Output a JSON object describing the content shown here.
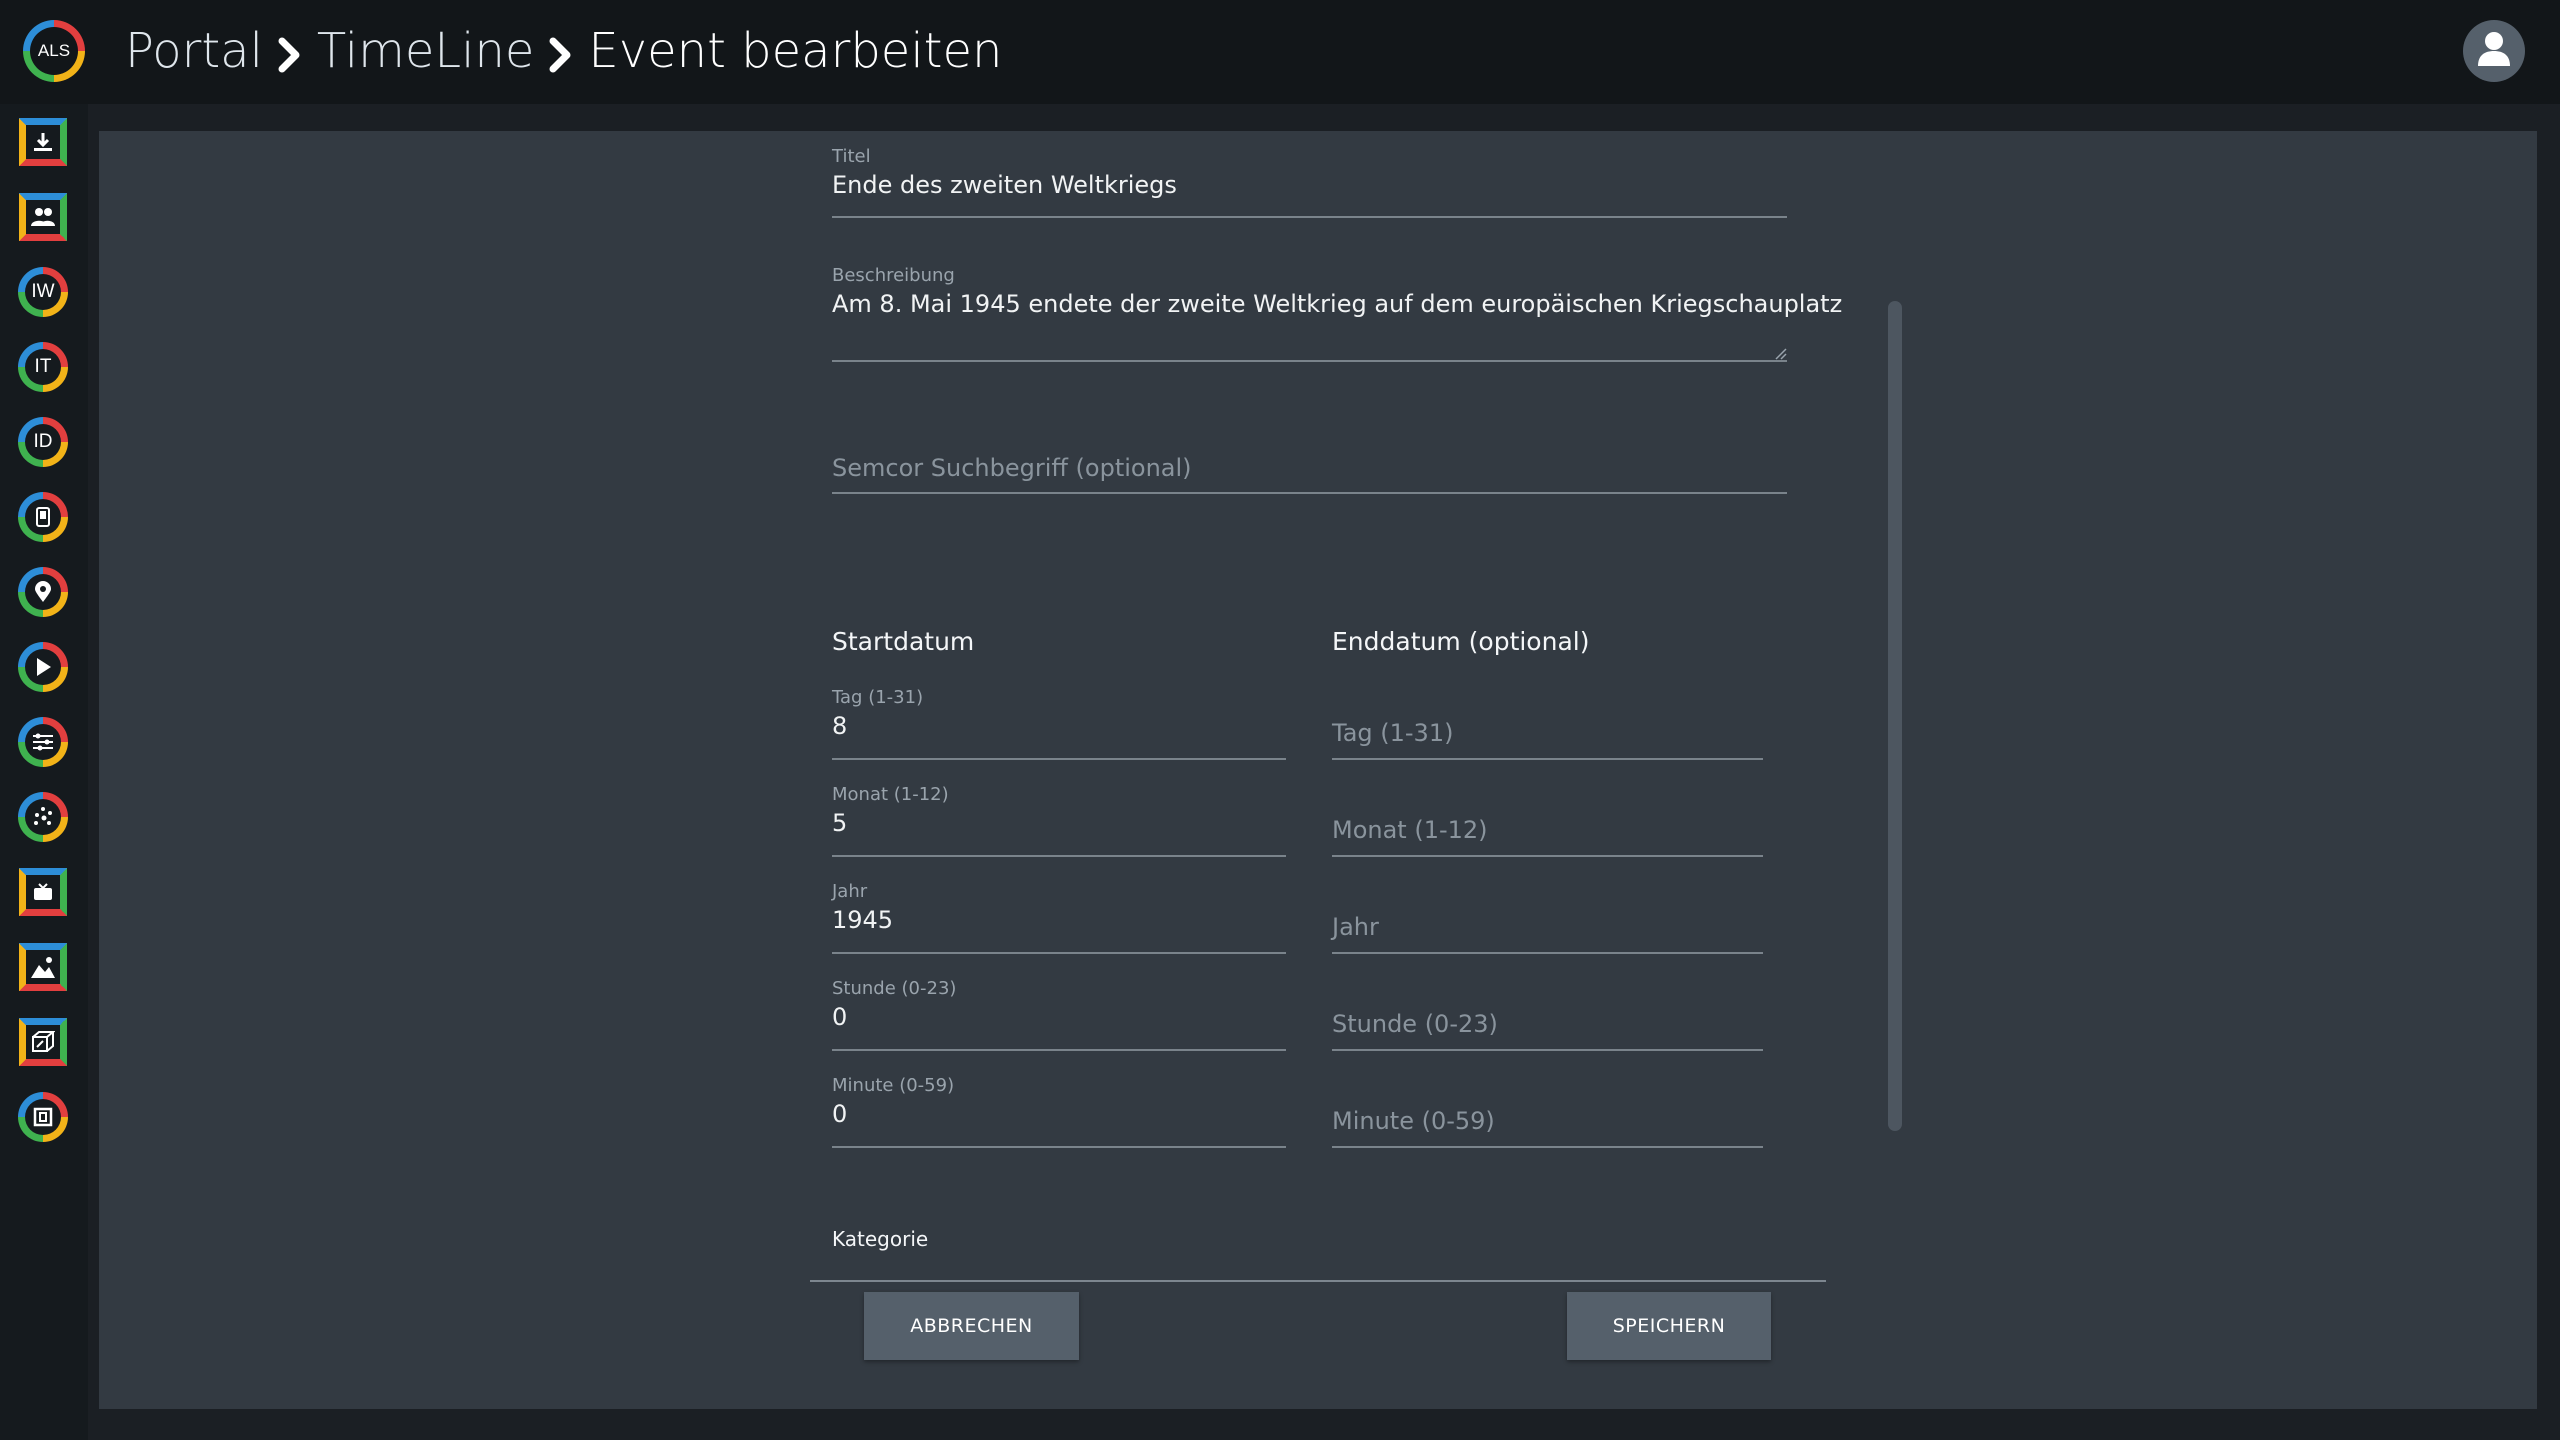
{
  "app": {
    "logo_text": "ALS"
  },
  "breadcrumb": {
    "items": [
      "Portal",
      "TimeLine",
      "Event bearbeiten"
    ]
  },
  "sidebar": {
    "items": [
      {
        "name": "upload-icon"
      },
      {
        "name": "people-icon"
      },
      {
        "name": "iw-icon",
        "text": "IW"
      },
      {
        "name": "it-icon",
        "text": "IT"
      },
      {
        "name": "id-icon",
        "text": "ID"
      },
      {
        "name": "device-icon"
      },
      {
        "name": "location-pin-icon"
      },
      {
        "name": "play-icon"
      },
      {
        "name": "list-settings-icon"
      },
      {
        "name": "dots-chart-icon"
      },
      {
        "name": "tv-icon"
      },
      {
        "name": "image-icon"
      },
      {
        "name": "cube-icon"
      },
      {
        "name": "frame-icon"
      }
    ]
  },
  "form": {
    "title": {
      "label": "Titel",
      "value": "Ende des zweiten Weltkriegs"
    },
    "description": {
      "label": "Beschreibung",
      "value": "Am 8. Mai 1945 endete der zweite Weltkrieg auf dem europäischen Kriegschauplatz"
    },
    "semcor": {
      "placeholder": "Semcor Suchbegriff (optional)"
    },
    "start": {
      "heading": "Startdatum",
      "day": {
        "label": "Tag (1-31)",
        "value": "8"
      },
      "month": {
        "label": "Monat (1-12)",
        "value": "5"
      },
      "year": {
        "label": "Jahr",
        "value": "1945"
      },
      "hour": {
        "label": "Stunde (0-23)",
        "value": "0"
      },
      "minute": {
        "label": "Minute (0-59)",
        "value": "0"
      }
    },
    "end": {
      "heading": "Enddatum (optional)",
      "day": {
        "placeholder": "Tag (1-31)"
      },
      "month": {
        "placeholder": "Monat (1-12)"
      },
      "year": {
        "placeholder": "Jahr"
      },
      "hour": {
        "placeholder": "Stunde (0-23)"
      },
      "minute": {
        "placeholder": "Minute (0-59)"
      }
    },
    "category": {
      "label": "Kategorie"
    }
  },
  "buttons": {
    "cancel": "ABBRECHEN",
    "save": "SPEICHERN"
  },
  "colors": {
    "topbar": "#121619",
    "panel": "#333a42",
    "button": "#55606b"
  }
}
